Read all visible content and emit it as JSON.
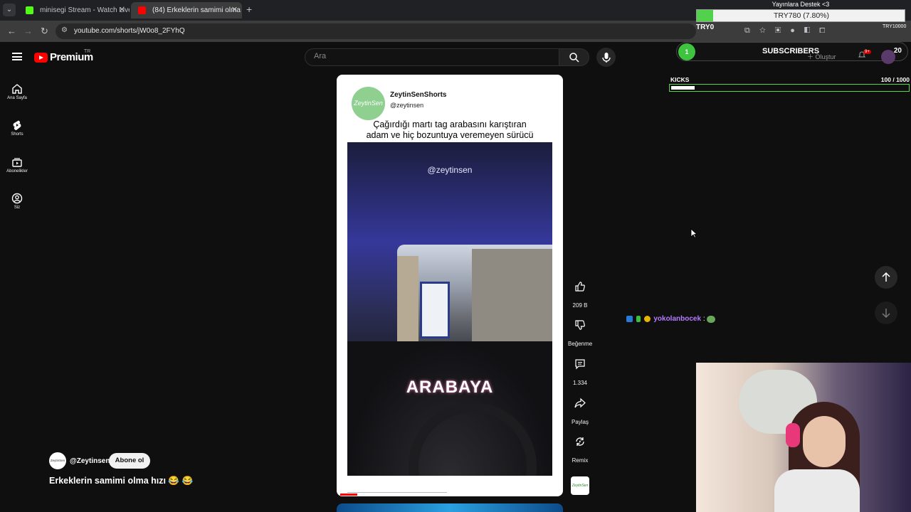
{
  "browser": {
    "tabs": [
      {
        "title": "minisegi Stream - Watch Live o",
        "active": false,
        "favicon_color": "#53fc18"
      },
      {
        "title": "(84) Erkeklerin samimi olma",
        "active": true,
        "favicon_color": "#ff0000"
      }
    ],
    "url": "youtube.com/shorts/jW0o8_2FYhQ"
  },
  "yt_header": {
    "logo_text": "Premium",
    "region": "TR",
    "search_placeholder": "Ara"
  },
  "sidebar": {
    "items": [
      {
        "label": "Ana Sayfa",
        "icon": "home-icon"
      },
      {
        "label": "Shorts",
        "icon": "shorts-icon"
      },
      {
        "label": "Abonelikler",
        "icon": "subscriptions-icon"
      },
      {
        "label": "Siz",
        "icon": "you-icon"
      }
    ]
  },
  "short": {
    "channel_name": "ZeytinSenShorts",
    "channel_handle": "@zeytinsen",
    "avatar_text": "ZeytinSen",
    "caption_line1": "Çağırdığı martı tag arabasını karıştıran",
    "caption_line2": "adam ve hiç bozuntuya veremeyen sürücü",
    "video_watermark": "@zeytinsen",
    "overlay_word": "ARABAYA",
    "progress": 0.08
  },
  "actions": {
    "like_count": "209 B",
    "dislike_label": "Beğenme",
    "comment_count": "1.334",
    "share_label": "Paylaş",
    "remix_label": "Remix",
    "channel_thumb_text": "ZeytinSen"
  },
  "channel_bar": {
    "avatar_text": "ZeytinSen",
    "handle": "@Zeytinsen",
    "subscribe_label": "Abone ol",
    "title": "Erkeklerin samimi olma hızı 😂 😂"
  },
  "stream_overlay": {
    "donation_title": "Yayınlara Destek <3",
    "donation_text": "TRY780 (7.80%)",
    "donation_progress": 0.078,
    "goal_start": "TRY0",
    "goal_end": "TRY10000",
    "subs_number": "1",
    "subs_label": "SUBSCRIBERS",
    "subs_count": "20",
    "create_label": "Oluştur",
    "notif_badge": "9+",
    "kicks_label": "KICKS",
    "kicks_count": "100",
    "kicks_goal": "/ 1000",
    "kicks_progress": 0.1,
    "chat_user": "yokolanbocek",
    "chat_sep": ":"
  }
}
